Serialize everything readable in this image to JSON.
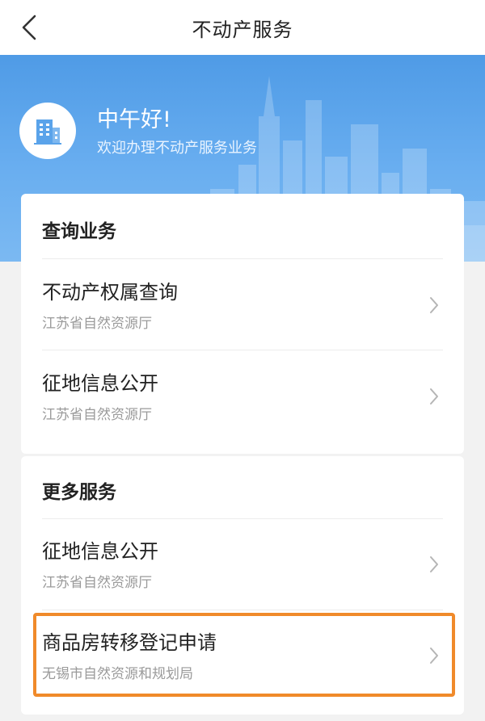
{
  "navbar": {
    "title": "不动产服务"
  },
  "hero": {
    "greeting": "中午好!",
    "welcome": "欢迎办理不动产服务业务"
  },
  "query_section": {
    "title": "查询业务",
    "items": [
      {
        "title": "不动产权属查询",
        "subtitle": "江苏省自然资源厅"
      },
      {
        "title": "征地信息公开",
        "subtitle": "江苏省自然资源厅"
      }
    ]
  },
  "more_section": {
    "title": "更多服务",
    "items": [
      {
        "title": "征地信息公开",
        "subtitle": "江苏省自然资源厅"
      },
      {
        "title": "商品房转移登记申请",
        "subtitle": "无锡市自然资源和规划局"
      }
    ]
  },
  "colors": {
    "hero_blue": "#4f9be6",
    "highlight_orange": "#f08a2a"
  }
}
